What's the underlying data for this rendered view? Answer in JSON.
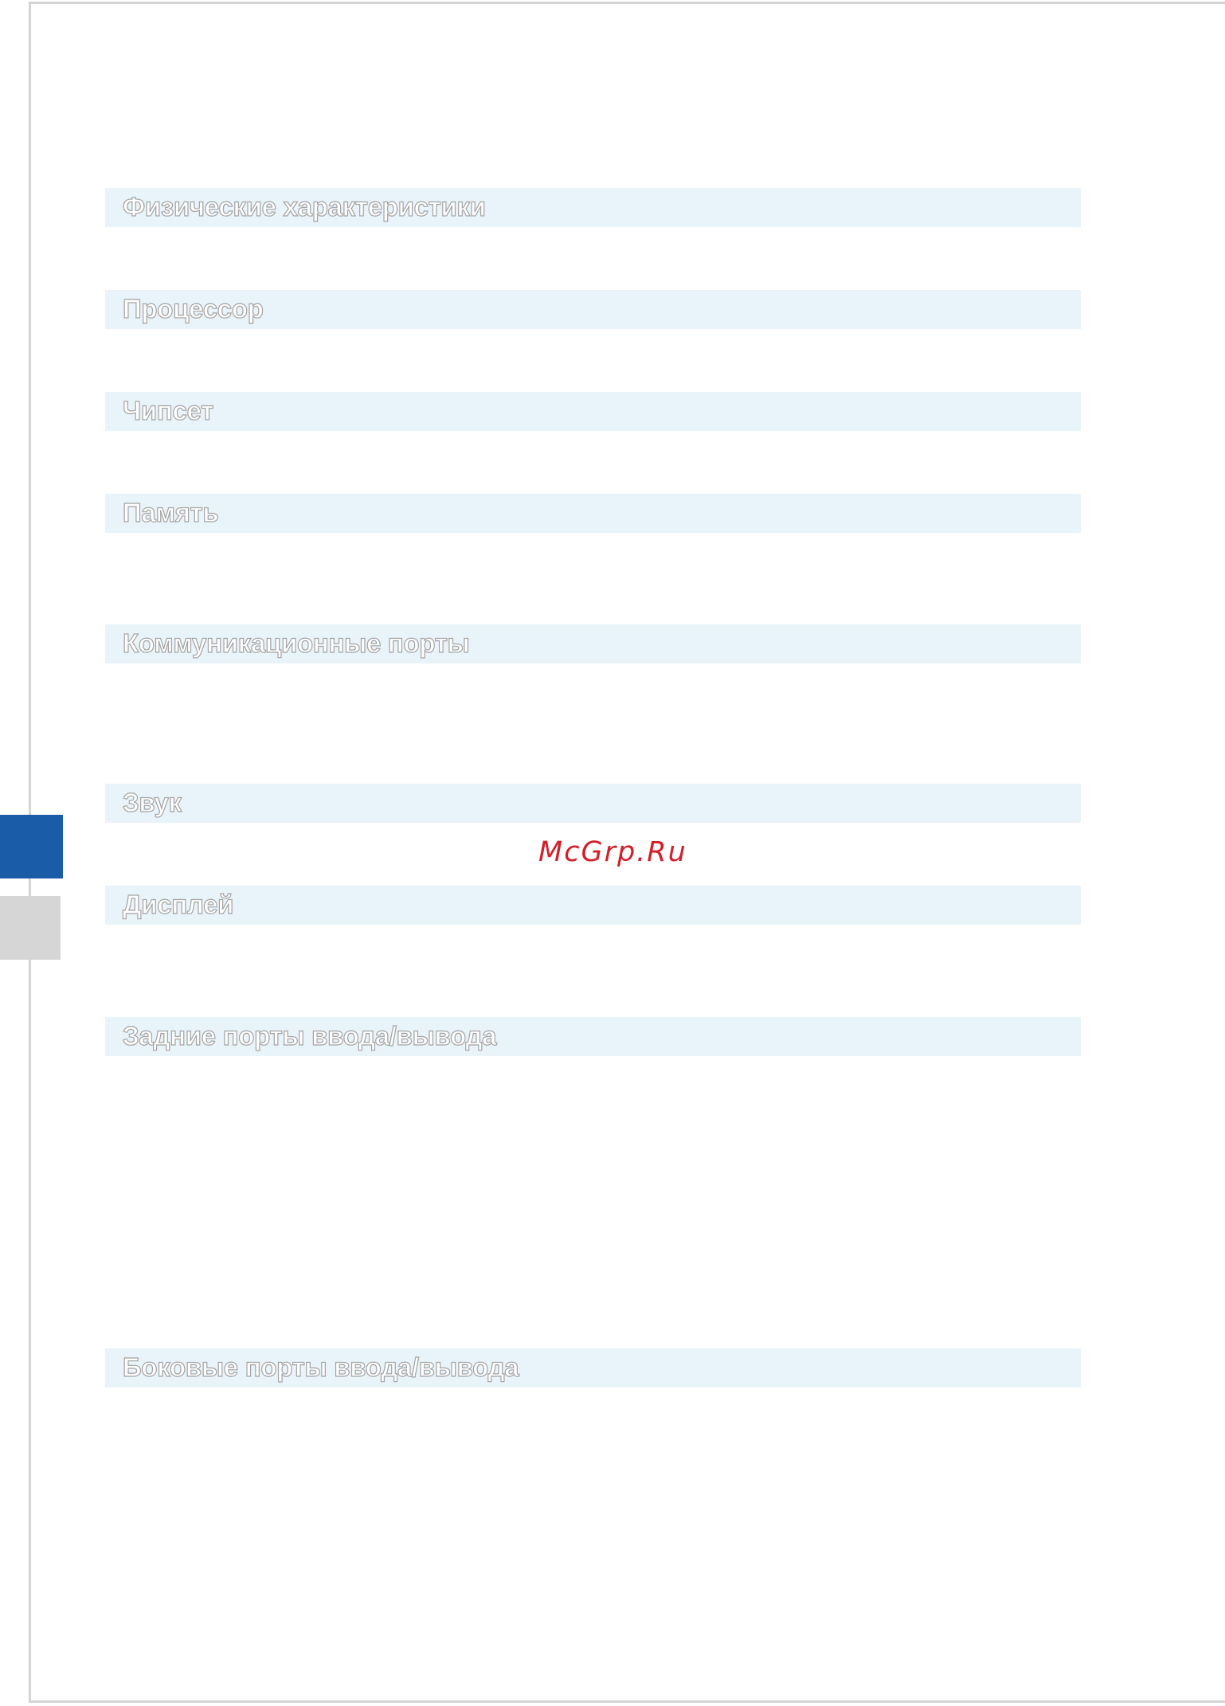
{
  "sections": [
    {
      "title": "Физические характеристики"
    },
    {
      "title": "Процессор"
    },
    {
      "title": "Чипсет"
    },
    {
      "title": "Память"
    },
    {
      "title": "Коммуникационные порты"
    },
    {
      "title": "Звук"
    },
    {
      "title": "Дисплей"
    },
    {
      "title": "Задние порты ввода/вывода"
    },
    {
      "title": "Боковые порты ввода/вывода"
    }
  ],
  "watermark": "McGrp.Ru",
  "colors": {
    "section_background": "#e8f3fa",
    "active_side_tab": "#1b5ca8",
    "inactive_side_tab": "#d6d6d6",
    "watermark": "#d0202a"
  }
}
